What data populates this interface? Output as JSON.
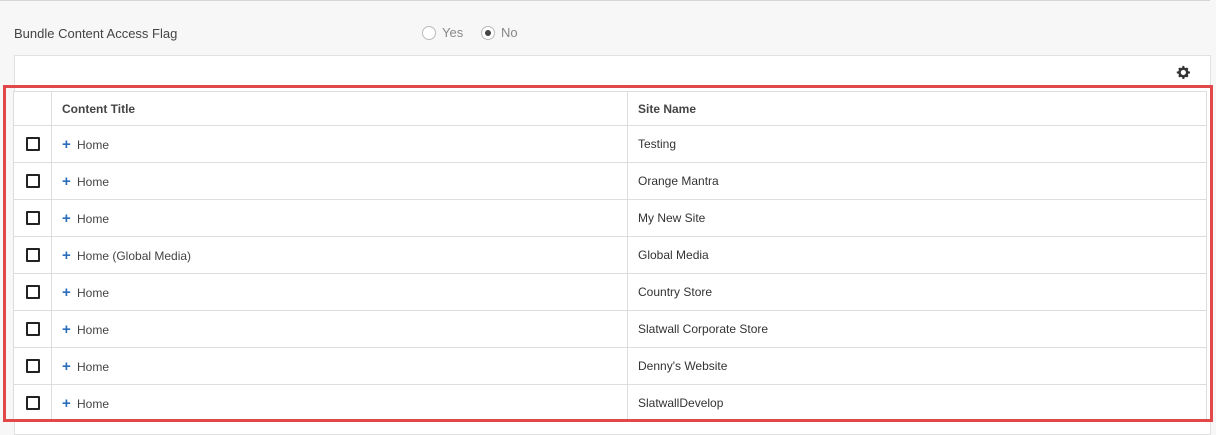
{
  "bundle_flag": {
    "label": "Bundle Content Access Flag",
    "options": [
      {
        "label": "Yes",
        "checked": false
      },
      {
        "label": "No",
        "checked": true
      }
    ]
  },
  "toolbar": {
    "settings_icon": "gear-icon"
  },
  "table": {
    "columns": [
      "Content Title",
      "Site Name"
    ],
    "rows": [
      {
        "title": "Home",
        "site": "Testing"
      },
      {
        "title": "Home",
        "site": "Orange Mantra"
      },
      {
        "title": "Home",
        "site": "My New Site"
      },
      {
        "title": "Home (Global Media)",
        "site": "Global Media"
      },
      {
        "title": "Home",
        "site": "Country Store"
      },
      {
        "title": "Home",
        "site": "Slatwall Corporate Store"
      },
      {
        "title": "Home",
        "site": "Denny's Website"
      },
      {
        "title": "Home",
        "site": "SlatwallDevelop"
      }
    ]
  },
  "colors": {
    "highlight": "#e0484a",
    "plus": "#2a6ebb"
  }
}
